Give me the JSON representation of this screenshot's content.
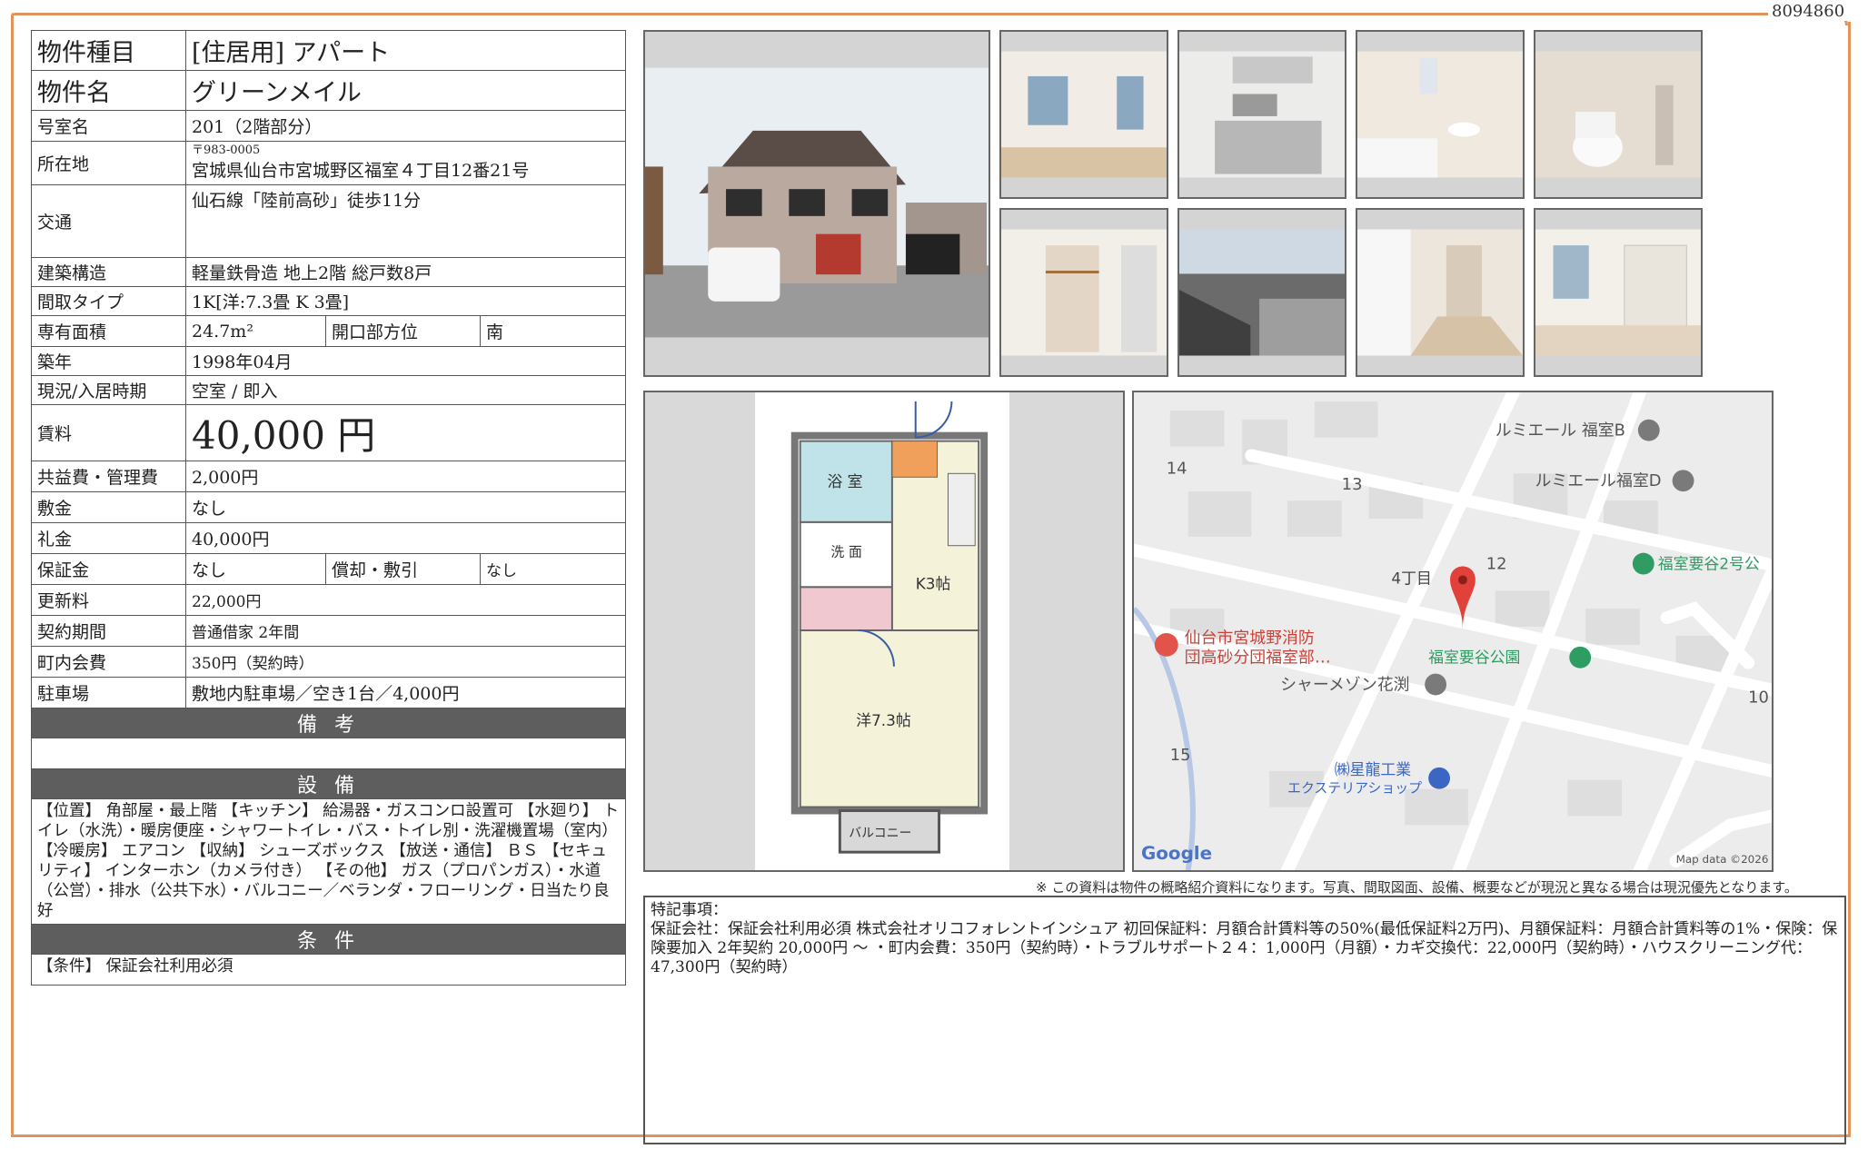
{
  "doc_id": "8094860",
  "property": {
    "type_label": "物件種目",
    "type_value": "[住居用] アパート",
    "name_label": "物件名",
    "name_value": "グリーンメイル",
    "room_label": "号室名",
    "room_value": "201（2階部分）",
    "location_label": "所在地",
    "zip": "〒983-0005",
    "address": "宮城県仙台市宮城野区福室４丁目12番21号",
    "transport_label": "交通",
    "transport_value": "仙石線「陸前高砂」徒歩11分",
    "structure_label": "建築構造",
    "structure_value": "軽量鉄骨造 地上2階 総戸数8戸",
    "layout_label": "間取タイプ",
    "layout_value": "1K[洋:7.3畳 K 3畳]",
    "area_label": "専有面積",
    "area_value": "24.7m²",
    "opening_label": "開口部方位",
    "opening_value": "南",
    "built_label": "築年",
    "built_value": "1998年04月",
    "status_label": "現況/入居時期",
    "status_value": "空室 / 即入",
    "rent_label": "賃料",
    "rent_value": "40,000 円",
    "fee_label": "共益費・管理費",
    "fee_value": "2,000円",
    "deposit_label": "敷金",
    "deposit_value": "なし",
    "key_money_label": "礼金",
    "key_money_value": "40,000円",
    "security_label": "保証金",
    "security_value": "なし",
    "amort_label": "償却・敷引",
    "amort_value": "なし",
    "renewal_label": "更新料",
    "renewal_value": "22,000円",
    "contract_label": "契約期間",
    "contract_value": "普通借家 2年間",
    "assoc_label": "町内会費",
    "assoc_value": "350円（契約時）",
    "parking_label": "駐車場",
    "parking_value": "敷地内駐車場／空き1台／4,000円"
  },
  "sections": {
    "notes_title": "備 考",
    "notes_value": "",
    "equip_title": "設 備",
    "equip_value": "【位置】 角部屋・最上階 【キッチン】 給湯器・ガスコンロ設置可 【水廻り】 トイレ（水洗）・暖房便座・シャワートイレ・バス・トイレ別・洗濯機置場（室内） 【冷暖房】 エアコン 【収納】 シューズボックス 【放送・通信】 ＢＳ 【セキュリティ】 インターホン（カメラ付き） 【その他】 ガス（プロパンガス）・水道（公営）・排水（公共下水）・バルコニー／ベランダ・フローリング・日当たり良好",
    "cond_title": "条 件",
    "cond_value": "【条件】 保証会社利用必須"
  },
  "floorplan": {
    "bath": "浴 室",
    "wash": "洗 面",
    "kitchen": "K3帖",
    "western": "洋7.3帖",
    "balcony": "バルコニー"
  },
  "map": {
    "labels": {
      "lumiere_b": "ルミエール 福室B",
      "lumiere_d": "ルミエール福室D",
      "park2": "福室要谷2号公",
      "fire_1": "仙台市宮城野消防",
      "fire_2": "団高砂分団福室部…",
      "park": "福室要谷公園",
      "charme": "シャーメゾン花渕",
      "seiryu_1": "㈱星龍工業",
      "seiryu_2": "エクステリアショップ",
      "chome": "4丁目",
      "n14": "14",
      "n13": "13",
      "n12": "12",
      "n15": "15",
      "n10": "10",
      "google": "Google",
      "mapdata": "Map data ©2026"
    }
  },
  "notice": "※ この資料は物件の概略紹介資料になります。写真、間取図面、設備、概要などが現況と異なる場合は現況優先となります。",
  "remarks": {
    "title": "特記事項：",
    "body": "保証会社：保証会社利用必須 株式会社オリコフォレントインシュア 初回保証料：月額合計賃料等の50%(最低保証料2万円)、月額保証料：月額合計賃料等の1%・保険：保険要加入 2年契約 20,000円 〜 ・町内会費：350円（契約時）・トラブルサポート２４：1,000円（月額）・カギ交換代：22,000円（契約時）・ハウスクリーニング代：47,300円（契約時）"
  }
}
